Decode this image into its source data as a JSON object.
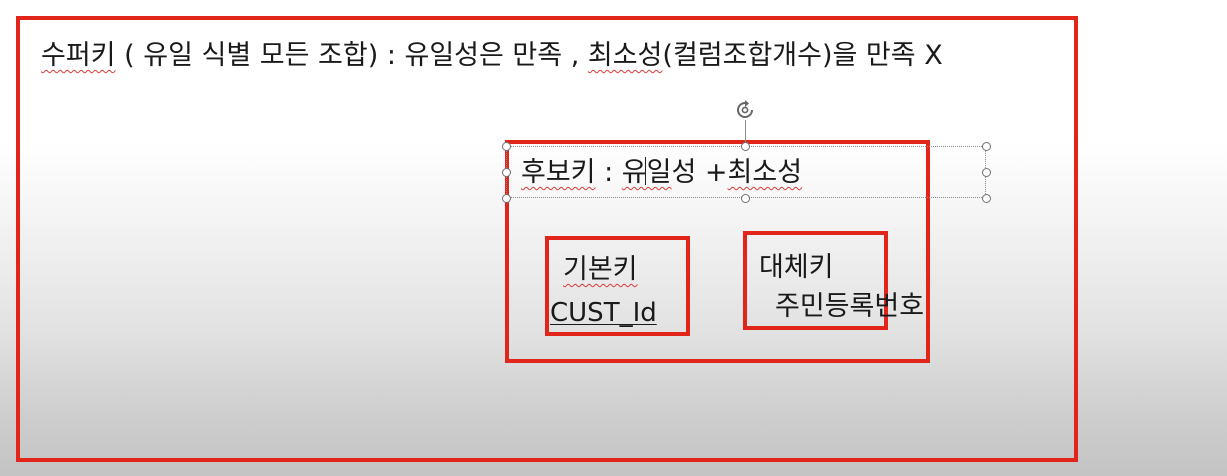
{
  "superkey_line": {
    "term": "수퍼키",
    "rest": " ( 유일 식별 모든 조합) : 유일성은 만족 , ",
    "minimality": "최소성",
    "tail": "(컬럼조합개수)을 만족 X"
  },
  "candidate_key": {
    "term": "후보키",
    "separator": " : ",
    "uniqueness": "유일",
    "uniqueness_suffix": "성",
    "plus": " +",
    "minimality": "최소성"
  },
  "primary_key": {
    "label": "기본키",
    "value": "CUST_Id"
  },
  "alternate_key": {
    "label": "대체키",
    "value": "주민등록번호"
  },
  "colors": {
    "outline": "#e1251b",
    "spellcheck": "#d83a3a"
  },
  "icons": {
    "rotate": "rotate-handle-icon"
  }
}
